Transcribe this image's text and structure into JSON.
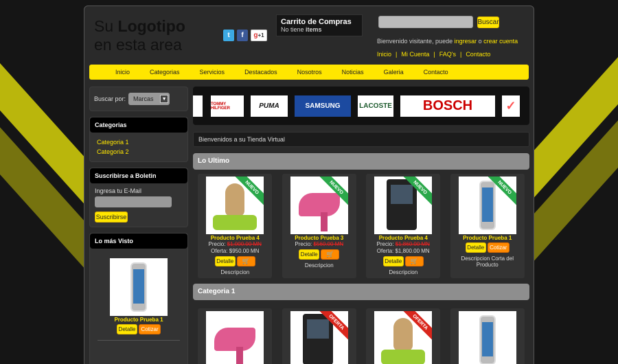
{
  "header": {
    "logo_line1": "Su Logotipo",
    "logo_line2": "en esta area",
    "social": [
      "twitter-icon",
      "facebook-icon",
      "google-plus-icon"
    ],
    "google_plus_label": "+1",
    "cart_title": "Carrito de Compras",
    "cart_status_prefix": "No tiene ",
    "cart_status_bold": "items",
    "search_button": "Buscar",
    "welcome_prefix": "Bienvenido visitante, puede ",
    "welcome_login": "ingresar",
    "welcome_or": " o ",
    "welcome_register": "crear cuenta",
    "top_links": [
      "Inicio",
      "Mi Cuenta",
      "FAQ's",
      "Contacto"
    ]
  },
  "menu": [
    "Inicio",
    "Categorias",
    "Servicios",
    "Destacados",
    "Nosotros",
    "Noticias",
    "Galeria",
    "Contacto"
  ],
  "sidebar": {
    "search_label": "Buscar por:",
    "search_select": "Marcas",
    "categories_title": "Categorias",
    "categories": [
      "Categoria 1",
      "Categoria 2"
    ],
    "newsletter_title": "Suscribirse a Boletin",
    "newsletter_label": "Ingresa tu E-Mail",
    "newsletter_button": "Suscribirse",
    "most_viewed_title": "Lo más Visto",
    "most_viewed_product": "Producto Prueba 1",
    "detail_button": "Detalle",
    "quote_button": "Cotizar"
  },
  "brands": [
    "TOMMY HILFIGER",
    "PUMA",
    "SAMSUNG",
    "LACOSTE",
    "BOSCH"
  ],
  "main": {
    "welcome": "Bienvenidos a su Tienda Virtual",
    "section1": "Lo Ultimo",
    "section2": "Categoria 1",
    "products": [
      {
        "name": "Producto Prueba 4",
        "price_label": "Precio:",
        "price": "$1,000.00 MN",
        "offer": "Oferta: $950.00 MN",
        "buttons": "detail-cart",
        "desc": "Descripcion",
        "ribbon": "NUEVO",
        "img": "bunny"
      },
      {
        "name": "Producto Prueba 3",
        "price_label": "Precio:",
        "price": "$560.00 MN",
        "offer": "",
        "buttons": "detail-cart",
        "desc": "Descripcion",
        "ribbon": "NUEVO",
        "img": "shoe"
      },
      {
        "name": "Producto Prueba 4",
        "price_label": "Precio:",
        "price": "$1,860.00 MN",
        "offer": "Oferta: $1,800.00 MN",
        "buttons": "detail-cart",
        "desc": "Descripcion",
        "ribbon": "NUEVO",
        "img": "blackberry"
      },
      {
        "name": "Producto Prueba 1",
        "price_label": "",
        "price": "",
        "offer": "",
        "buttons": "detail-quote",
        "desc": "Descripcion Corta del Producto",
        "ribbon": "NUEVO",
        "img": "phone"
      }
    ],
    "category_images": [
      "shoe",
      "blackberry",
      "bunny",
      "phone"
    ],
    "category_ribbon": "OFERTA"
  },
  "colors": {
    "accent": "#ffe600",
    "new_ribbon": "#2aa84a",
    "offer_ribbon": "#d9261c",
    "quote_button": "#ff8a00"
  }
}
